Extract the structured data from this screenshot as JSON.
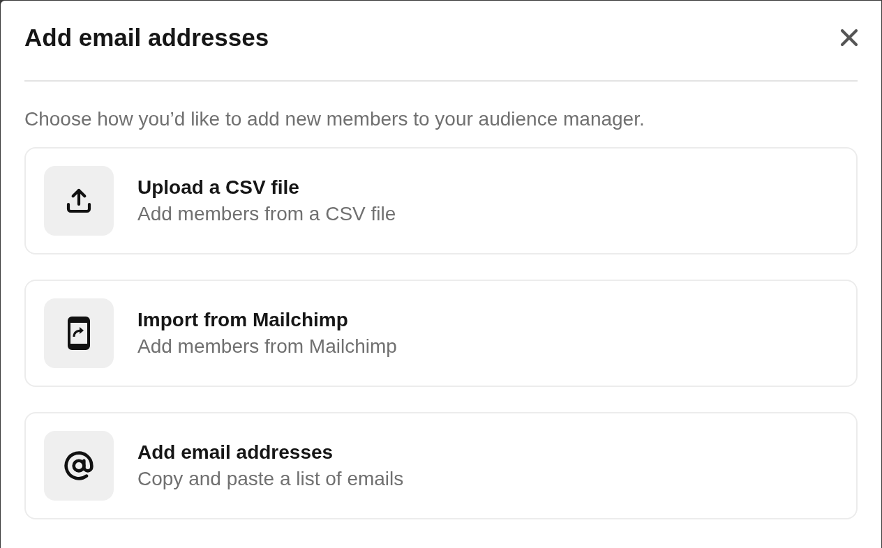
{
  "dialog": {
    "title": "Add email addresses",
    "description": "Choose how you’d like to add new members to your audience manager.",
    "options": [
      {
        "kind": "upload",
        "title": "Upload a CSV file",
        "subtitle": "Add members from a CSV file"
      },
      {
        "kind": "import",
        "title": "Import from Mailchimp",
        "subtitle": "Add members from Mailchimp"
      },
      {
        "kind": "email",
        "title": "Add email addresses",
        "subtitle": "Copy and paste a list of emails"
      }
    ]
  }
}
